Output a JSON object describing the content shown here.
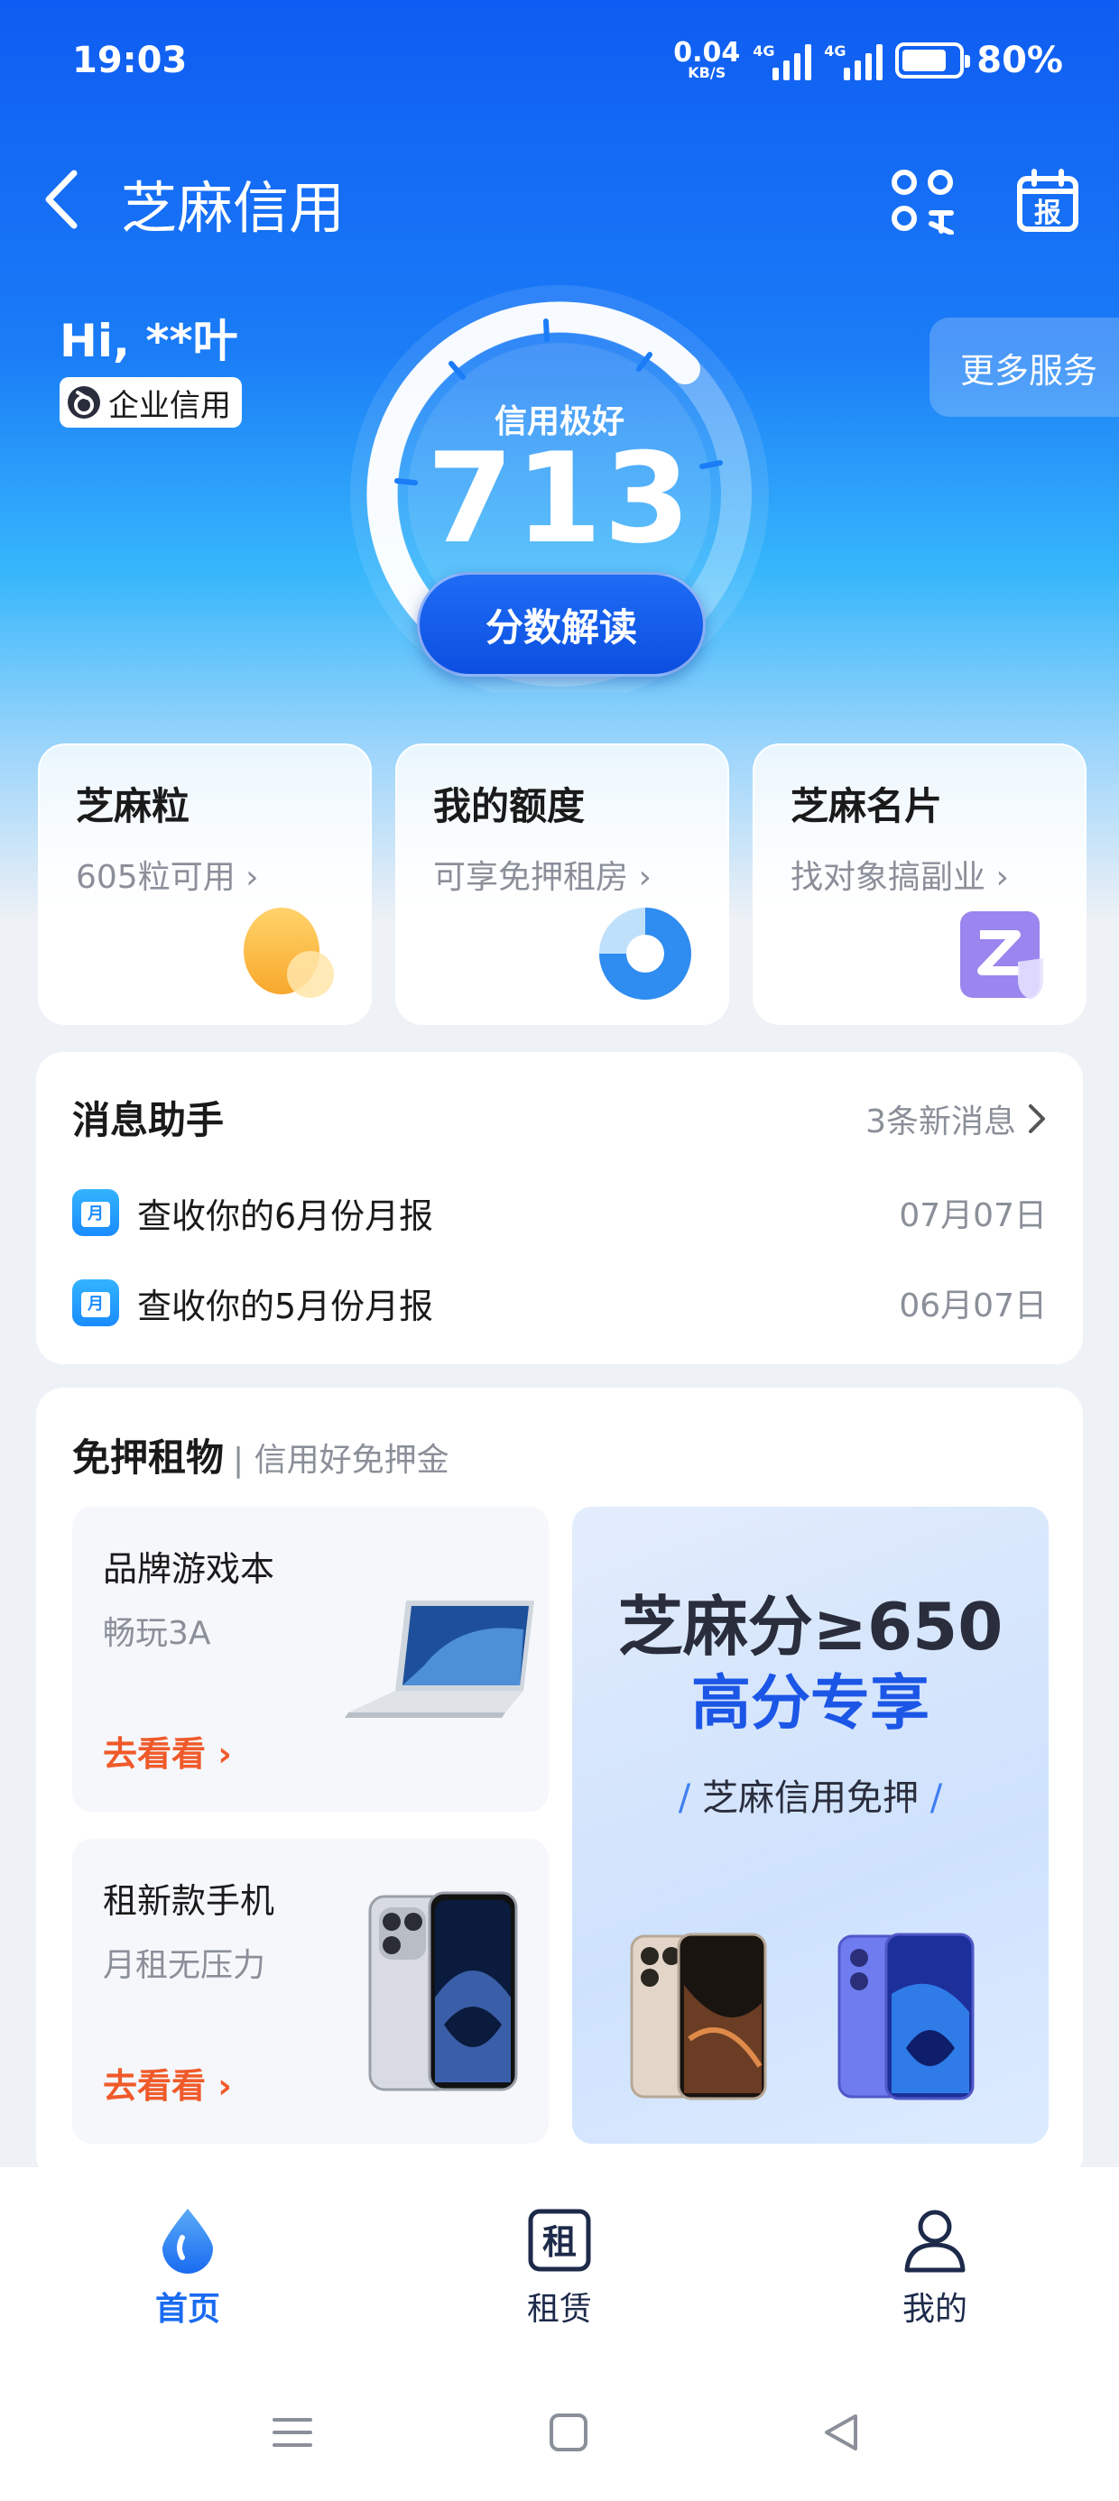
{
  "status_bar": {
    "time": "19:03",
    "net_speed": "0.04",
    "net_unit": "KB/S",
    "net1": "4G",
    "net2": "4G",
    "battery": "80%",
    "battery_level": 0.8
  },
  "header": {
    "title": "芝麻信用"
  },
  "profile": {
    "greeting": "Hi, **叶",
    "tag": "企业信用"
  },
  "more_services": "更多服务",
  "score": {
    "label": "信用极好",
    "value": "713",
    "button": "分数解读"
  },
  "feature_cards": [
    {
      "title": "芝麻粒",
      "subtitle": "605粒可用"
    },
    {
      "title": "我的额度",
      "subtitle": "可享免押租房"
    },
    {
      "title": "芝麻名片",
      "subtitle": "找对象搞副业"
    }
  ],
  "messages": {
    "title": "消息助手",
    "new_count": "3条新消息",
    "items": [
      {
        "text": "查收你的6月份月报",
        "date": "07月07日"
      },
      {
        "text": "查收你的5月份月报",
        "date": "06月07日"
      }
    ]
  },
  "rent": {
    "title": "免押租物",
    "subtitle": "| 信用好免押金",
    "items": [
      {
        "title": "品牌游戏本",
        "subtitle": "畅玩3A",
        "link": "去看看 ›"
      },
      {
        "title": "租新款手机",
        "subtitle": "月租无压力",
        "link": "去看看 ›"
      }
    ],
    "promo": {
      "line1": "芝麻分≥650",
      "line2": "高分专享",
      "line3": "芝麻信用免押"
    }
  },
  "tabs": [
    {
      "label": "首页",
      "active": true
    },
    {
      "label": "租赁",
      "active": false
    },
    {
      "label": "我的",
      "active": false
    }
  ],
  "colors": {
    "primary_blue": "#1a6bf0",
    "accent_orange": "#f05a2a",
    "hero_top": "#0f5cf2",
    "hero_mid": "#36b6fb"
  }
}
